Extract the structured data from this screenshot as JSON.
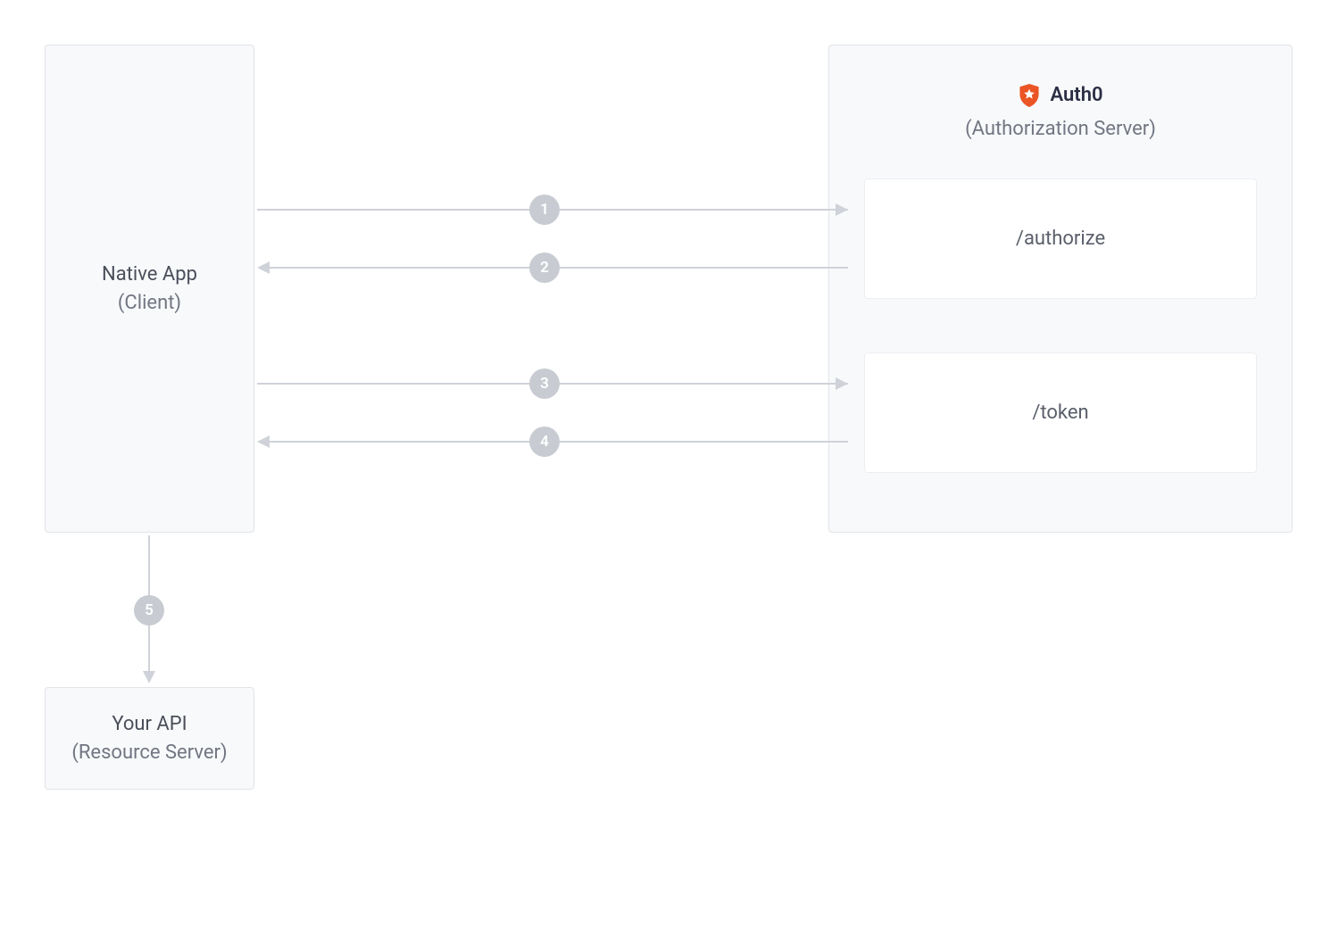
{
  "client": {
    "title": "Native App",
    "subtitle": "(Client)"
  },
  "authServer": {
    "brand": "Auth0",
    "subtitle": "(Authorization Server)",
    "endpoints": {
      "authorize": "/authorize",
      "token": "/token"
    }
  },
  "resourceServer": {
    "title": "Your API",
    "subtitle": "(Resource Server)"
  },
  "steps": {
    "s1": "1",
    "s2": "2",
    "s3": "3",
    "s4": "4",
    "s5": "5"
  },
  "colors": {
    "auth0Accent": "#EB5424"
  }
}
